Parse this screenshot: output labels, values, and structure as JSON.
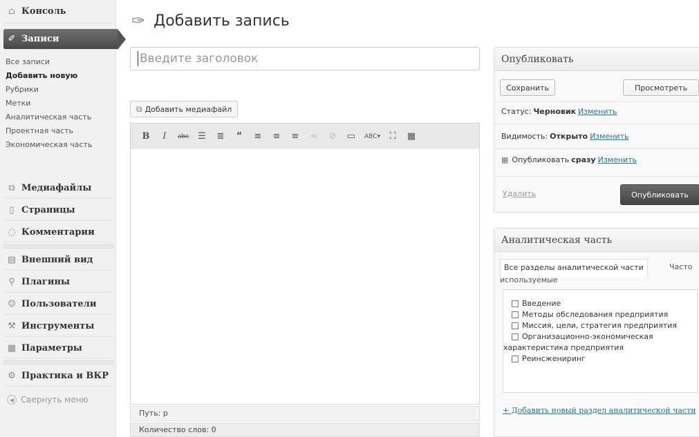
{
  "sidebar": {
    "console": "Консоль",
    "posts": "Записи",
    "submenu": [
      "Все записи",
      "Добавить новую",
      "Рубрики",
      "Метки",
      "Аналитическая часть",
      "Проектная часть",
      "Экономическая часть"
    ],
    "media": "Медиафайлы",
    "pages": "Страницы",
    "comments": "Комментарии",
    "appearance": "Внешний вид",
    "plugins": "Плагины",
    "users": "Пользователи",
    "tools": "Инструменты",
    "settings": "Параметры",
    "practice": "Практика и ВКР",
    "collapse": "Свернуть меню"
  },
  "header": {
    "title": "Добавить запись"
  },
  "editor": {
    "title_placeholder": "Введите заголовок",
    "add_media": "Добавить медиафайл",
    "path": "Путь: p",
    "word_count": "Количество слов: 0"
  },
  "publish": {
    "title": "Опубликовать",
    "save": "Сохранить",
    "preview": "Просмотреть",
    "status_label": "Статус:",
    "status_value": "Черновик",
    "visibility_label": "Видимость:",
    "visibility_value": "Открыто",
    "publish_label": "Опубликовать",
    "publish_value": "сразу",
    "edit": "Изменить",
    "delete": "Удалить",
    "publish_button": "Опубликовать"
  },
  "analytic": {
    "title": "Аналитическая часть",
    "tab_all": "Все разделы аналитической части",
    "tab_frequent_1": "Часто",
    "tab_frequent_2": "используемые",
    "categories": [
      "Введение",
      "Методы обследования предприятия",
      "Миссия, цели, стратегия предприятия",
      "Организационно-экономическая"
    ],
    "category_continuation": "характеристика предприятия",
    "category_last": "Реинсжениринг",
    "add_new": "+ Добавить новый раздел аналитической части"
  }
}
